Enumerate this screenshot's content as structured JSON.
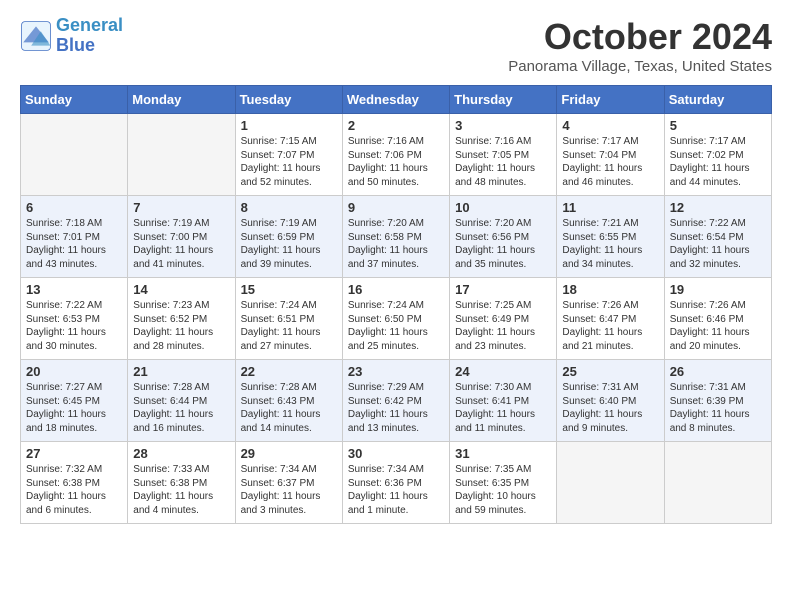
{
  "logo": {
    "line1": "General",
    "line2": "Blue"
  },
  "title": "October 2024",
  "location": "Panorama Village, Texas, United States",
  "days_of_week": [
    "Sunday",
    "Monday",
    "Tuesday",
    "Wednesday",
    "Thursday",
    "Friday",
    "Saturday"
  ],
  "weeks": [
    [
      {
        "day": "",
        "sunrise": "",
        "sunset": "",
        "daylight": ""
      },
      {
        "day": "",
        "sunrise": "",
        "sunset": "",
        "daylight": ""
      },
      {
        "day": "1",
        "sunrise": "Sunrise: 7:15 AM",
        "sunset": "Sunset: 7:07 PM",
        "daylight": "Daylight: 11 hours and 52 minutes."
      },
      {
        "day": "2",
        "sunrise": "Sunrise: 7:16 AM",
        "sunset": "Sunset: 7:06 PM",
        "daylight": "Daylight: 11 hours and 50 minutes."
      },
      {
        "day": "3",
        "sunrise": "Sunrise: 7:16 AM",
        "sunset": "Sunset: 7:05 PM",
        "daylight": "Daylight: 11 hours and 48 minutes."
      },
      {
        "day": "4",
        "sunrise": "Sunrise: 7:17 AM",
        "sunset": "Sunset: 7:04 PM",
        "daylight": "Daylight: 11 hours and 46 minutes."
      },
      {
        "day": "5",
        "sunrise": "Sunrise: 7:17 AM",
        "sunset": "Sunset: 7:02 PM",
        "daylight": "Daylight: 11 hours and 44 minutes."
      }
    ],
    [
      {
        "day": "6",
        "sunrise": "Sunrise: 7:18 AM",
        "sunset": "Sunset: 7:01 PM",
        "daylight": "Daylight: 11 hours and 43 minutes."
      },
      {
        "day": "7",
        "sunrise": "Sunrise: 7:19 AM",
        "sunset": "Sunset: 7:00 PM",
        "daylight": "Daylight: 11 hours and 41 minutes."
      },
      {
        "day": "8",
        "sunrise": "Sunrise: 7:19 AM",
        "sunset": "Sunset: 6:59 PM",
        "daylight": "Daylight: 11 hours and 39 minutes."
      },
      {
        "day": "9",
        "sunrise": "Sunrise: 7:20 AM",
        "sunset": "Sunset: 6:58 PM",
        "daylight": "Daylight: 11 hours and 37 minutes."
      },
      {
        "day": "10",
        "sunrise": "Sunrise: 7:20 AM",
        "sunset": "Sunset: 6:56 PM",
        "daylight": "Daylight: 11 hours and 35 minutes."
      },
      {
        "day": "11",
        "sunrise": "Sunrise: 7:21 AM",
        "sunset": "Sunset: 6:55 PM",
        "daylight": "Daylight: 11 hours and 34 minutes."
      },
      {
        "day": "12",
        "sunrise": "Sunrise: 7:22 AM",
        "sunset": "Sunset: 6:54 PM",
        "daylight": "Daylight: 11 hours and 32 minutes."
      }
    ],
    [
      {
        "day": "13",
        "sunrise": "Sunrise: 7:22 AM",
        "sunset": "Sunset: 6:53 PM",
        "daylight": "Daylight: 11 hours and 30 minutes."
      },
      {
        "day": "14",
        "sunrise": "Sunrise: 7:23 AM",
        "sunset": "Sunset: 6:52 PM",
        "daylight": "Daylight: 11 hours and 28 minutes."
      },
      {
        "day": "15",
        "sunrise": "Sunrise: 7:24 AM",
        "sunset": "Sunset: 6:51 PM",
        "daylight": "Daylight: 11 hours and 27 minutes."
      },
      {
        "day": "16",
        "sunrise": "Sunrise: 7:24 AM",
        "sunset": "Sunset: 6:50 PM",
        "daylight": "Daylight: 11 hours and 25 minutes."
      },
      {
        "day": "17",
        "sunrise": "Sunrise: 7:25 AM",
        "sunset": "Sunset: 6:49 PM",
        "daylight": "Daylight: 11 hours and 23 minutes."
      },
      {
        "day": "18",
        "sunrise": "Sunrise: 7:26 AM",
        "sunset": "Sunset: 6:47 PM",
        "daylight": "Daylight: 11 hours and 21 minutes."
      },
      {
        "day": "19",
        "sunrise": "Sunrise: 7:26 AM",
        "sunset": "Sunset: 6:46 PM",
        "daylight": "Daylight: 11 hours and 20 minutes."
      }
    ],
    [
      {
        "day": "20",
        "sunrise": "Sunrise: 7:27 AM",
        "sunset": "Sunset: 6:45 PM",
        "daylight": "Daylight: 11 hours and 18 minutes."
      },
      {
        "day": "21",
        "sunrise": "Sunrise: 7:28 AM",
        "sunset": "Sunset: 6:44 PM",
        "daylight": "Daylight: 11 hours and 16 minutes."
      },
      {
        "day": "22",
        "sunrise": "Sunrise: 7:28 AM",
        "sunset": "Sunset: 6:43 PM",
        "daylight": "Daylight: 11 hours and 14 minutes."
      },
      {
        "day": "23",
        "sunrise": "Sunrise: 7:29 AM",
        "sunset": "Sunset: 6:42 PM",
        "daylight": "Daylight: 11 hours and 13 minutes."
      },
      {
        "day": "24",
        "sunrise": "Sunrise: 7:30 AM",
        "sunset": "Sunset: 6:41 PM",
        "daylight": "Daylight: 11 hours and 11 minutes."
      },
      {
        "day": "25",
        "sunrise": "Sunrise: 7:31 AM",
        "sunset": "Sunset: 6:40 PM",
        "daylight": "Daylight: 11 hours and 9 minutes."
      },
      {
        "day": "26",
        "sunrise": "Sunrise: 7:31 AM",
        "sunset": "Sunset: 6:39 PM",
        "daylight": "Daylight: 11 hours and 8 minutes."
      }
    ],
    [
      {
        "day": "27",
        "sunrise": "Sunrise: 7:32 AM",
        "sunset": "Sunset: 6:38 PM",
        "daylight": "Daylight: 11 hours and 6 minutes."
      },
      {
        "day": "28",
        "sunrise": "Sunrise: 7:33 AM",
        "sunset": "Sunset: 6:38 PM",
        "daylight": "Daylight: 11 hours and 4 minutes."
      },
      {
        "day": "29",
        "sunrise": "Sunrise: 7:34 AM",
        "sunset": "Sunset: 6:37 PM",
        "daylight": "Daylight: 11 hours and 3 minutes."
      },
      {
        "day": "30",
        "sunrise": "Sunrise: 7:34 AM",
        "sunset": "Sunset: 6:36 PM",
        "daylight": "Daylight: 11 hours and 1 minute."
      },
      {
        "day": "31",
        "sunrise": "Sunrise: 7:35 AM",
        "sunset": "Sunset: 6:35 PM",
        "daylight": "Daylight: 10 hours and 59 minutes."
      },
      {
        "day": "",
        "sunrise": "",
        "sunset": "",
        "daylight": ""
      },
      {
        "day": "",
        "sunrise": "",
        "sunset": "",
        "daylight": ""
      }
    ]
  ]
}
